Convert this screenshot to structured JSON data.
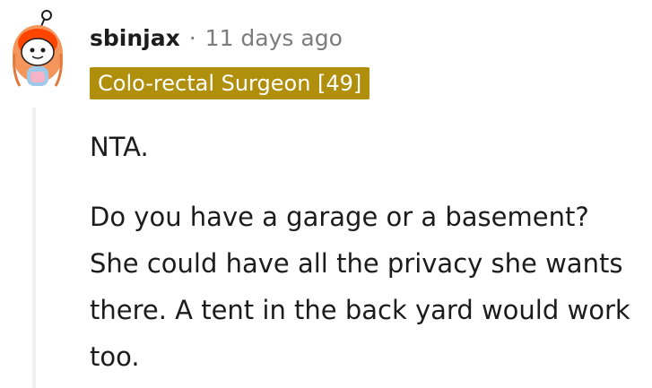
{
  "comment": {
    "author": "sbinjax",
    "separator": "·",
    "timestamp": "11 days ago",
    "flair": "Colo-rectal Surgeon [49]",
    "paragraphs": [
      "NTA.",
      "Do you have a garage or a basement? She could have all the privacy she wants there. A tent in the back yard would work too."
    ]
  },
  "colors": {
    "flair_background": "#b08f0c",
    "avatar_accent": "#ff4500",
    "meta_text": "#7c7c7c"
  },
  "icons": {
    "avatar": "snoo-avatar-icon"
  }
}
